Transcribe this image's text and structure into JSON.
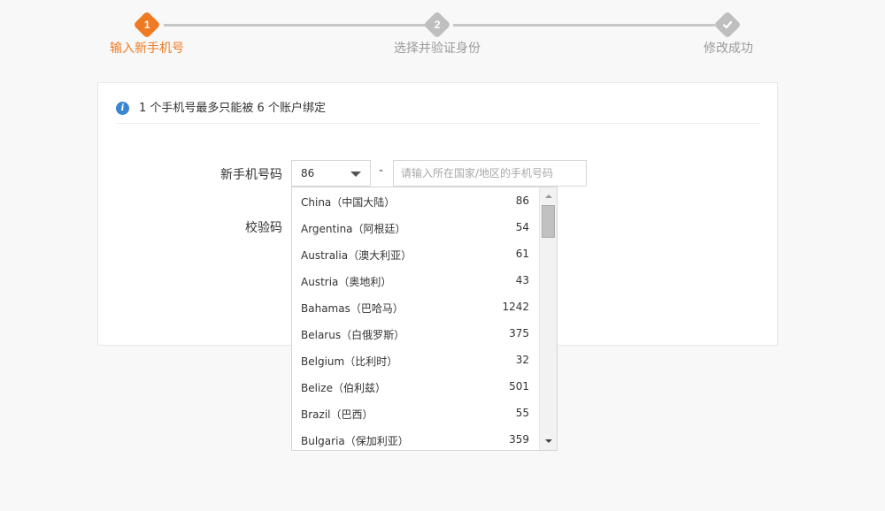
{
  "steps": [
    {
      "number": "1",
      "label": "输入新手机号",
      "state": "active"
    },
    {
      "number": "2",
      "label": "选择并验证身份",
      "state": "inactive"
    },
    {
      "number": "",
      "label": "修改成功",
      "state": "done",
      "icon": "check-icon"
    }
  ],
  "colors": {
    "accent": "#f07a22",
    "inactive": "#bfbfbf",
    "info": "#3b86d1"
  },
  "notice": {
    "icon": "info-icon",
    "glyph": "i",
    "text": "1 个手机号最多只能被 6 个账户绑定"
  },
  "form": {
    "phone_label": "新手机号码",
    "code_label": "校验码",
    "country_code_value": "86",
    "separator": "-",
    "phone_placeholder": "请输入所在国家/地区的手机号码",
    "phone_value": ""
  },
  "dropdown": {
    "options": [
      {
        "name": "China（中国大陆）",
        "code": "86"
      },
      {
        "name": "Argentina（阿根廷）",
        "code": "54"
      },
      {
        "name": "Australia（澳大利亚）",
        "code": "61"
      },
      {
        "name": "Austria（奥地利）",
        "code": "43"
      },
      {
        "name": "Bahamas（巴哈马）",
        "code": "1242"
      },
      {
        "name": "Belarus（白俄罗斯）",
        "code": "375"
      },
      {
        "name": "Belgium（比利时）",
        "code": "32"
      },
      {
        "name": "Belize（伯利兹）",
        "code": "501"
      },
      {
        "name": "Brazil（巴西）",
        "code": "55"
      },
      {
        "name": "Bulgaria（保加利亚）",
        "code": "359"
      }
    ]
  }
}
